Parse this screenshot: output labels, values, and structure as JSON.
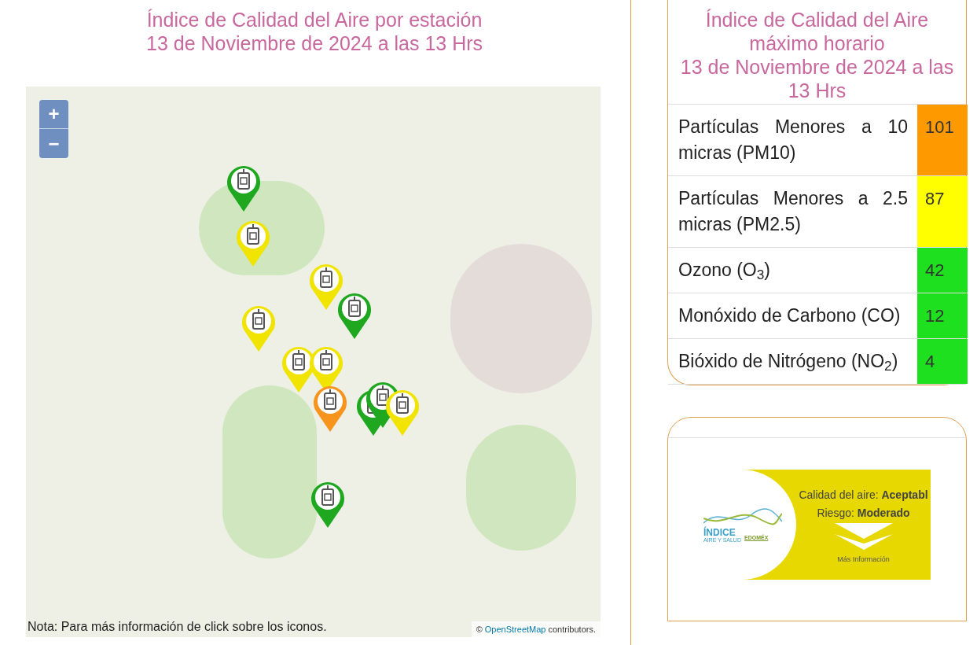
{
  "left": {
    "title_lines": [
      "Índice de Calidad del Aire por estación",
      "13 de Noviembre de 2024 a las 13 Hrs"
    ],
    "map": {
      "zoom_in": "+",
      "zoom_out": "−",
      "attribution_prefix": "©",
      "attribution_link": "OpenStreetMap",
      "attribution_suffix": "contributors.",
      "markers": [
        {
          "color": "#1fa81f"
        },
        {
          "color": "#f0e400"
        },
        {
          "color": "#f0e400"
        },
        {
          "color": "#1fa81f"
        },
        {
          "color": "#f0e400"
        },
        {
          "color": "#f0e400"
        },
        {
          "color": "#f0e400"
        },
        {
          "color": "#f7941d"
        },
        {
          "color": "#1fa81f"
        },
        {
          "color": "#1fa81f"
        },
        {
          "color": "#f0e400"
        },
        {
          "color": "#1fa81f"
        }
      ]
    },
    "note": "Nota: Para más información de click sobre los iconos."
  },
  "right": {
    "title_lines": [
      "Índice de Calidad del Aire",
      "máximo horario",
      "13 de Noviembre de 2024 a las",
      "13 Hrs"
    ],
    "pollutants": [
      {
        "name": "Partículas Menores a 10 micras (PM10)",
        "value": "101",
        "color": "#ff9900"
      },
      {
        "name": "Partículas Menores a 2.5 micras (PM2.5)",
        "value": "87",
        "color": "#ffff00"
      },
      {
        "name": "Ozono (O$_{3}$)",
        "value": "42",
        "color": "#1ee01e"
      },
      {
        "name": "Monóxido de Carbono (CO)",
        "value": "12",
        "color": "#1ee01e"
      },
      {
        "name": "Bióxido de Nitrógeno (NO$_{2}$)",
        "value": "4",
        "color": "#1ee01e"
      }
    ],
    "banner": {
      "logo_title": "ÍNDICE",
      "logo_subtitle": "AIRE Y SALUD",
      "logo_region": "EDOMÉX",
      "quality": "Calidad del aire: **Aceptabl**",
      "risk": "Riesgo: **Moderado**",
      "more": "Más Información"
    }
  }
}
